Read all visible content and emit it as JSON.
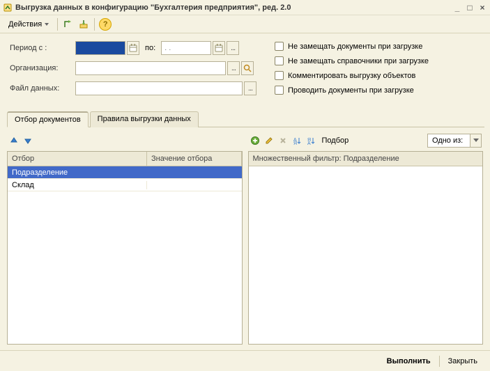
{
  "window": {
    "title": "Выгрузка данных в конфигурацию \"Бухгалтерия предприятия\", ред. 2.0"
  },
  "toolbar": {
    "actions_label": "Действия"
  },
  "form": {
    "period_label": "Период с :",
    "period_to": "по:",
    "period_from_value": "",
    "period_to_value": ". .",
    "organization_label": "Организация:",
    "organization_value": "",
    "datafile_label": "Файл данных:",
    "datafile_value": ""
  },
  "checkboxes": {
    "no_replace_docs": "Не замещать документы при загрузке",
    "no_replace_refs": "Не замещать справочники при загрузке",
    "comment_export": "Комментировать выгрузку объектов",
    "post_docs": "Проводить документы при загрузке"
  },
  "tabs": {
    "filter": "Отбор документов",
    "rules": "Правила выгрузки данных"
  },
  "left_grid": {
    "col_filter": "Отбор",
    "col_value": "Значение отбора",
    "rows": [
      {
        "filter": "Подразделение",
        "value": ""
      },
      {
        "filter": "Склад",
        "value": ""
      }
    ]
  },
  "right_panel": {
    "podb_label": "Подбор",
    "combo_value": "Одно из:",
    "header": "Множественный фильтр: Подразделение"
  },
  "footer": {
    "execute": "Выполнить",
    "close": "Закрыть"
  }
}
